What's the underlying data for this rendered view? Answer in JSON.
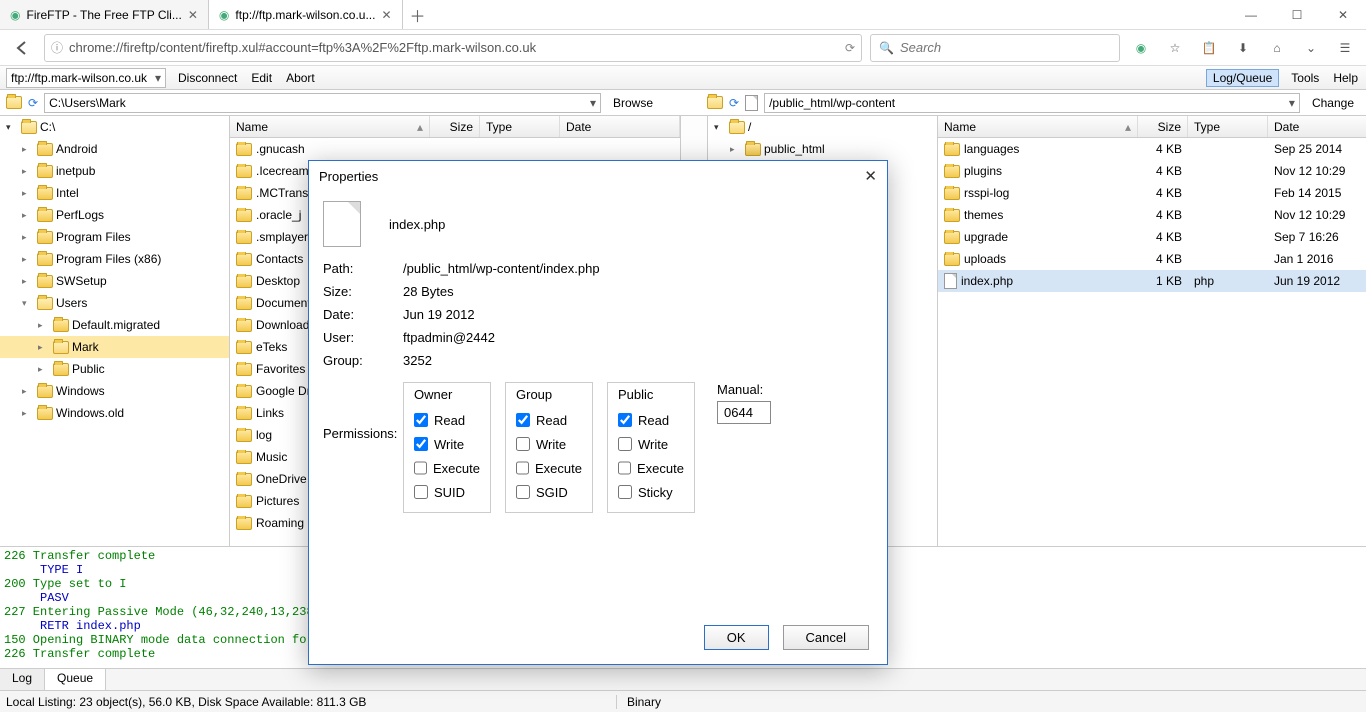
{
  "browser": {
    "tabs": [
      {
        "title": "FireFTP - The Free FTP Cli..."
      },
      {
        "title": "ftp://ftp.mark-wilson.co.u..."
      }
    ],
    "url": "chrome://fireftp/content/fireftp.xul#account=ftp%3A%2F%2Fftp.mark-wilson.co.uk",
    "search_placeholder": "Search"
  },
  "toolbar": {
    "account": "ftp://ftp.mark-wilson.co.uk",
    "disconnect": "Disconnect",
    "edit": "Edit",
    "abort": "Abort",
    "log_queue": "Log/Queue",
    "tools": "Tools",
    "help": "Help"
  },
  "local": {
    "path": "C:\\Users\\Mark",
    "browse": "Browse",
    "root": "C:\\",
    "tree": [
      {
        "name": "Android",
        "depth": 1
      },
      {
        "name": "inetpub",
        "depth": 1
      },
      {
        "name": "Intel",
        "depth": 1
      },
      {
        "name": "PerfLogs",
        "depth": 1
      },
      {
        "name": "Program Files",
        "depth": 1
      },
      {
        "name": "Program Files (x86)",
        "depth": 1
      },
      {
        "name": "SWSetup",
        "depth": 1
      },
      {
        "name": "Users",
        "depth": 1,
        "open": true
      },
      {
        "name": "Default.migrated",
        "depth": 2
      },
      {
        "name": "Mark",
        "depth": 2,
        "sel": true
      },
      {
        "name": "Public",
        "depth": 2
      },
      {
        "name": "Windows",
        "depth": 1
      },
      {
        "name": "Windows.old",
        "depth": 1
      }
    ],
    "cols": {
      "name": "Name",
      "size": "Size",
      "type": "Type",
      "date": "Date"
    },
    "files": [
      {
        "name": ".gnucash"
      },
      {
        "name": ".Icecream"
      },
      {
        "name": ".MCTrans"
      },
      {
        "name": ".oracle_j"
      },
      {
        "name": ".smplayer"
      },
      {
        "name": "Contacts"
      },
      {
        "name": "Desktop"
      },
      {
        "name": "Documents"
      },
      {
        "name": "Downloads"
      },
      {
        "name": "eTeks"
      },
      {
        "name": "Favorites"
      },
      {
        "name": "Google Drive"
      },
      {
        "name": "Links"
      },
      {
        "name": "log"
      },
      {
        "name": "Music"
      },
      {
        "name": "OneDrive"
      },
      {
        "name": "Pictures"
      },
      {
        "name": "Roaming"
      }
    ]
  },
  "remote": {
    "path": "/public_html/wp-content",
    "change": "Change",
    "root": "/",
    "tree_item": "public_html",
    "cols": {
      "name": "Name",
      "size": "Size",
      "type": "Type",
      "date": "Date"
    },
    "files": [
      {
        "name": "languages",
        "size": "4 KB",
        "type": "",
        "date": "Sep 25 2014",
        "folder": true
      },
      {
        "name": "plugins",
        "size": "4 KB",
        "type": "",
        "date": "Nov 12 10:29",
        "folder": true
      },
      {
        "name": "rsspi-log",
        "size": "4 KB",
        "type": "",
        "date": "Feb 14 2015",
        "folder": true
      },
      {
        "name": "themes",
        "size": "4 KB",
        "type": "",
        "date": "Nov 12 10:29",
        "folder": true
      },
      {
        "name": "upgrade",
        "size": "4 KB",
        "type": "",
        "date": "Sep 7 16:26",
        "folder": true
      },
      {
        "name": "uploads",
        "size": "4 KB",
        "type": "",
        "date": "Jan 1 2016",
        "folder": true
      },
      {
        "name": "index.php",
        "size": "1 KB",
        "type": "php",
        "date": "Jun 19 2012",
        "folder": false,
        "sel": true
      }
    ]
  },
  "log": [
    {
      "cls": "log-green",
      "text": "226 Transfer complete"
    },
    {
      "cls": "log-blue",
      "text": "TYPE I"
    },
    {
      "cls": "log-green",
      "text": "200 Type set to I"
    },
    {
      "cls": "log-blue",
      "text": "PASV"
    },
    {
      "cls": "log-green",
      "text": "227 Entering Passive Mode (46,32,240,13,238,208"
    },
    {
      "cls": "log-blue",
      "text": "RETR index.php"
    },
    {
      "cls": "log-green",
      "text": "150 Opening BINARY mode data connection for ind"
    },
    {
      "cls": "log-green",
      "text": "226 Transfer complete"
    }
  ],
  "bottom_tabs": {
    "log": "Log",
    "queue": "Queue"
  },
  "status": {
    "left": "Local Listing: 23 object(s), 56.0 KB, Disk Space Available: 811.3 GB",
    "binary": "Binary"
  },
  "dialog": {
    "title": "Properties",
    "filename": "index.php",
    "path_label": "Path:",
    "path": "/public_html/wp-content/index.php",
    "size_label": "Size:",
    "size": "28 Bytes",
    "date_label": "Date:",
    "date": "Jun 19 2012",
    "user_label": "User:",
    "user": "ftpadmin@2442",
    "group_label": "Group:",
    "group": "3252",
    "perm_label": "Permissions:",
    "owner": "Owner",
    "grp": "Group",
    "pub": "Public",
    "read": "Read",
    "write": "Write",
    "execute": "Execute",
    "suid": "SUID",
    "sgid": "SGID",
    "sticky": "Sticky",
    "manual_label": "Manual:",
    "manual": "0644",
    "ok": "OK",
    "cancel": "Cancel",
    "perms": {
      "owner": {
        "read": true,
        "write": true,
        "execute": false,
        "extra": false
      },
      "group": {
        "read": true,
        "write": false,
        "execute": false,
        "extra": false
      },
      "public": {
        "read": true,
        "write": false,
        "execute": false,
        "extra": false
      }
    }
  }
}
